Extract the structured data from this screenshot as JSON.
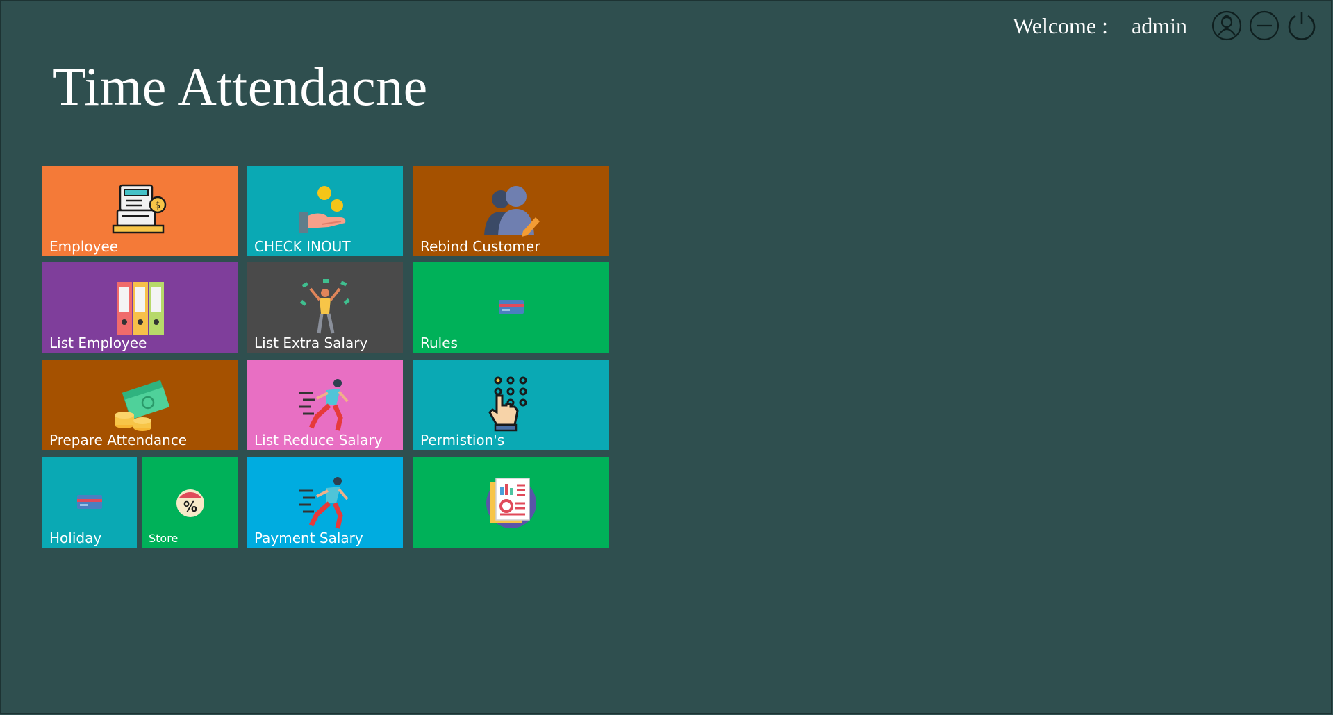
{
  "header": {
    "welcome_label": "Welcome :",
    "username": "admin",
    "title": "Time Attendacne"
  },
  "top_icons": [
    "user-icon",
    "minimize-icon",
    "power-icon"
  ],
  "tiles": [
    {
      "id": "employee",
      "label": "Employee",
      "color": "#f47a38",
      "icon": "cash-register-icon"
    },
    {
      "id": "check-inout",
      "label": "CHECK INOUT",
      "color": "#0aa9b4",
      "icon": "hand-coins-icon"
    },
    {
      "id": "rebind-customer",
      "label": "Rebind Customer",
      "color": "#a55100",
      "icon": "users-edit-icon"
    },
    {
      "id": "list-employee",
      "label": "List Employee",
      "color": "#7f3e9b",
      "icon": "binders-icon"
    },
    {
      "id": "list-extra-salary",
      "label": "List Extra Salary",
      "color": "#4a4a4a",
      "icon": "celebrating-person-icon"
    },
    {
      "id": "rules",
      "label": "Rules",
      "color": "#00b159",
      "icon": "card-icon"
    },
    {
      "id": "prepare-attendance",
      "label": "Prepare Attendance",
      "color": "#a55100",
      "icon": "money-coins-icon"
    },
    {
      "id": "list-reduce-salary",
      "label": "List Reduce Salary",
      "color": "#e86fc3",
      "icon": "running-person-icon"
    },
    {
      "id": "permissions",
      "label": "Permistion's",
      "color": "#0aa9b4",
      "icon": "keypad-hand-icon"
    },
    {
      "id": "holiday",
      "label": "Holiday",
      "color": "#0aa9b4",
      "icon": "card-icon"
    },
    {
      "id": "store",
      "label": "Store",
      "color": "#00b159",
      "icon": "discount-calendar-icon"
    },
    {
      "id": "payment-salary",
      "label": "Payment Salary",
      "color": "#00ace0",
      "icon": "running-person-icon"
    },
    {
      "id": "report",
      "label": "",
      "color": "#00b159",
      "icon": "report-icon"
    }
  ]
}
